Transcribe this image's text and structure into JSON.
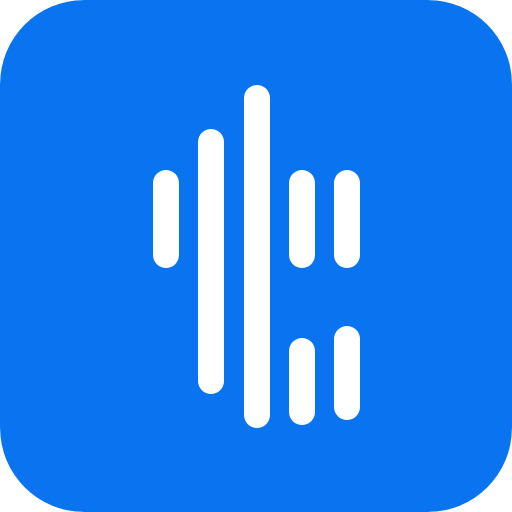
{
  "icon": {
    "name": "audio-waveform-app-icon",
    "background_color": "#0a74f0",
    "bar_color": "#ffffff"
  }
}
